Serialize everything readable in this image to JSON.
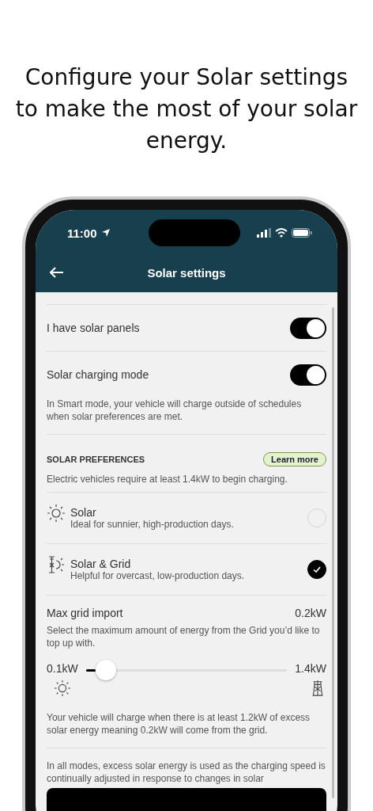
{
  "headline": "Configure your Solar settings to make the most of your solar energy.",
  "status_bar": {
    "time": "11:00"
  },
  "header": {
    "title": "Solar settings"
  },
  "toggles": [
    {
      "label": "I have solar panels",
      "on": true
    },
    {
      "label": "Solar charging mode",
      "on": true
    }
  ],
  "mode_note": "In Smart mode, your vehicle will charge outside of schedules when solar preferences are met.",
  "preferences": {
    "heading": "SOLAR PREFERENCES",
    "learn_more": "Learn more",
    "note": "Electric vehicles require at least 1.4kW to begin charging.",
    "options": [
      {
        "kind": "solar",
        "title": "Solar",
        "subtitle": "Ideal for sunnier, high-production days.",
        "selected": false
      },
      {
        "kind": "solar-grid",
        "title": "Solar & Grid",
        "subtitle": "Helpful for overcast, low-production days.",
        "selected": true
      }
    ]
  },
  "grid_import": {
    "label": "Max grid import",
    "value": "0.2kW",
    "description": "Select the maximum amount of energy from the Grid you’d like to top up with.",
    "min_label": "0.1kW",
    "max_label": "1.4kW",
    "level": 0.1,
    "explanation": "Your vehicle will charge when there is at least 1.2kW of excess solar energy meaning 0.2kW will come from the grid."
  },
  "footer_note": "In all modes, excess solar energy is used as the charging speed is continually adjusted in response to changes in solar"
}
